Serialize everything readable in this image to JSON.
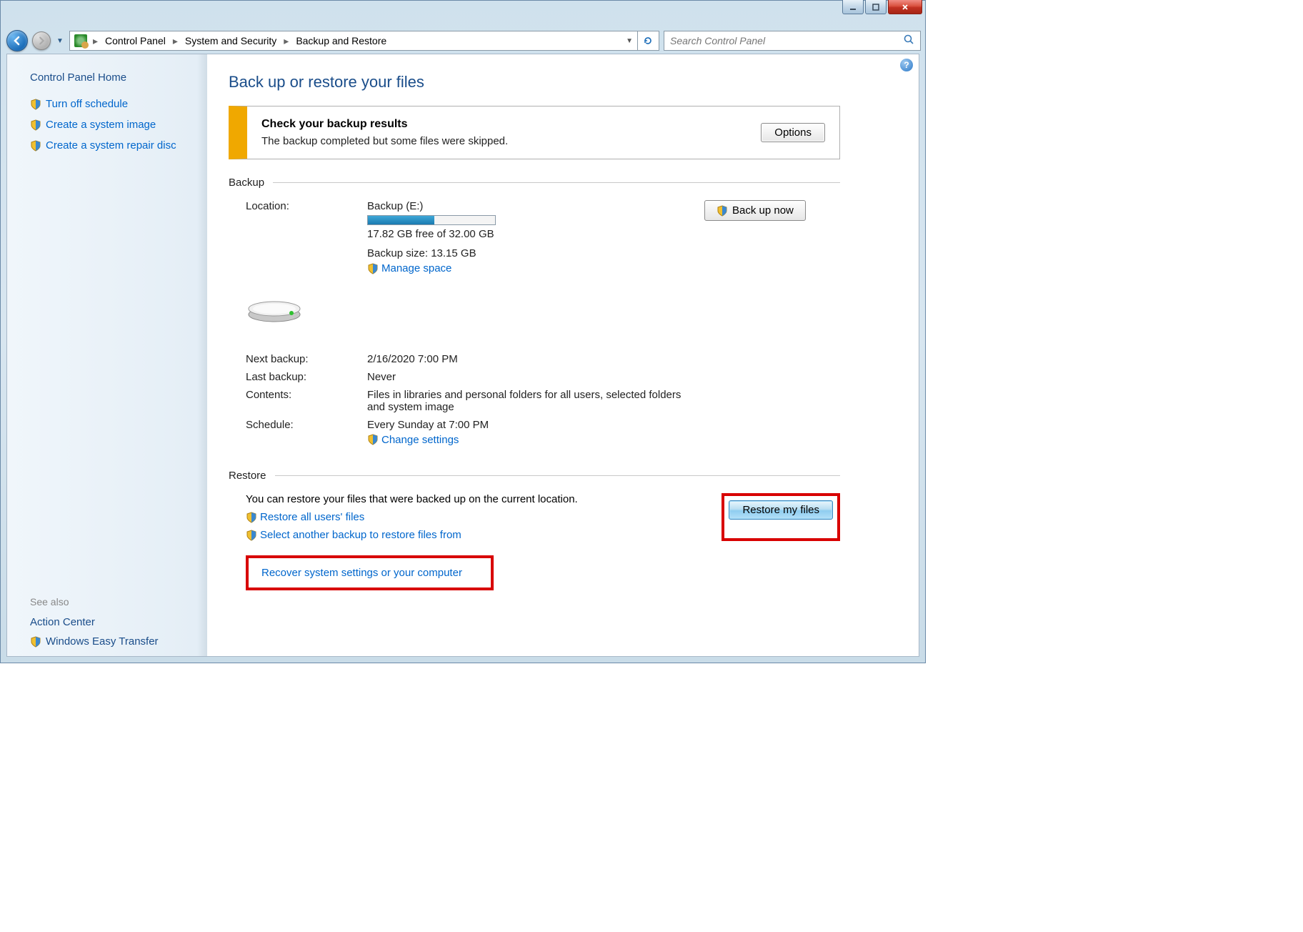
{
  "breadcrumb": {
    "seg1": "Control Panel",
    "seg2": "System and Security",
    "seg3": "Backup and Restore"
  },
  "search": {
    "placeholder": "Search Control Panel"
  },
  "sidebar": {
    "home": "Control Panel Home",
    "links": {
      "turn_off": "Turn off schedule",
      "create_image": "Create a system image",
      "create_repair": "Create a system repair disc"
    },
    "see_also": "See also",
    "action_center": "Action Center",
    "easy_transfer": "Windows Easy Transfer"
  },
  "page": {
    "title": "Back up or restore your files",
    "alert_heading": "Check your backup results",
    "alert_text": "The backup completed but some files were skipped.",
    "options_btn": "Options"
  },
  "backup": {
    "section": "Backup",
    "location_label": "Location:",
    "drive": "Backup (E:)",
    "free": "17.82 GB free of 32.00 GB",
    "size": "Backup size: 13.15 GB",
    "manage_space": "Manage space",
    "next_label": "Next backup:",
    "next_val": "2/16/2020 7:00 PM",
    "last_label": "Last backup:",
    "last_val": "Never",
    "contents_label": "Contents:",
    "contents_val": "Files in libraries and personal folders for all users, selected folders and system image",
    "schedule_label": "Schedule:",
    "schedule_val": "Every Sunday at 7:00 PM",
    "change_settings": "Change settings",
    "backup_now": "Back up now"
  },
  "restore": {
    "section": "Restore",
    "text": "You can restore your files that were backed up on the current location.",
    "restore_all": "Restore all users' files",
    "select_another": "Select another backup to restore files from",
    "restore_btn": "Restore my files",
    "recover": "Recover system settings or your computer"
  }
}
